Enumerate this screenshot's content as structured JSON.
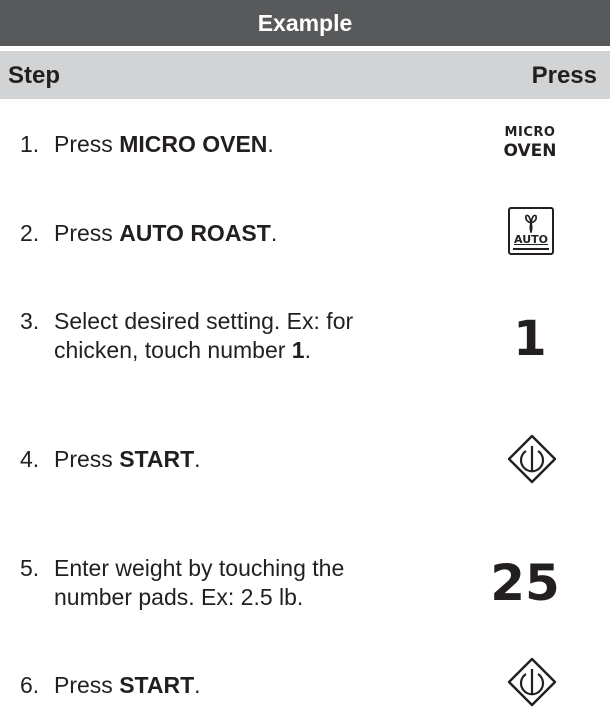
{
  "table": {
    "title": "Example",
    "header": {
      "step": "Step",
      "press": "Press"
    }
  },
  "steps": [
    {
      "number": "1.",
      "line1_pre": "Press ",
      "line1_bold": "MICRO OVEN",
      "line1_post": ".",
      "press": {
        "type": "label",
        "line1": "MICRO",
        "line2": "OVEN"
      }
    },
    {
      "number": "2.",
      "line1_pre": "Press ",
      "line1_bold": "AUTO ROAST",
      "line1_post": ".",
      "press": {
        "type": "auto-roast-button",
        "label": "AUTO",
        "icon": "fan-icon"
      }
    },
    {
      "number": "3.",
      "line1": "Select desired setting. Ex: for",
      "line2_pre": "chicken, touch number ",
      "line2_bold": "1",
      "line2_post": ".",
      "press": {
        "type": "digits",
        "value": "1"
      }
    },
    {
      "number": "4.",
      "line1_pre": "Press ",
      "line1_bold": "START",
      "line1_post": ".",
      "press": {
        "type": "start-button",
        "icon": "start-icon"
      }
    },
    {
      "number": "5.",
      "line1": "Enter weight by touching the",
      "line2": "number pads. Ex: 2.5 lb.",
      "press": {
        "type": "digits",
        "value": "25"
      }
    },
    {
      "number": "6.",
      "line1_pre": "Press ",
      "line1_bold": "START",
      "line1_post": ".",
      "press": {
        "type": "start-button",
        "icon": "start-icon"
      }
    }
  ],
  "colors": {
    "title_bg": "#58595b",
    "header_bg": "#d1d3d4",
    "text": "#231f20"
  }
}
